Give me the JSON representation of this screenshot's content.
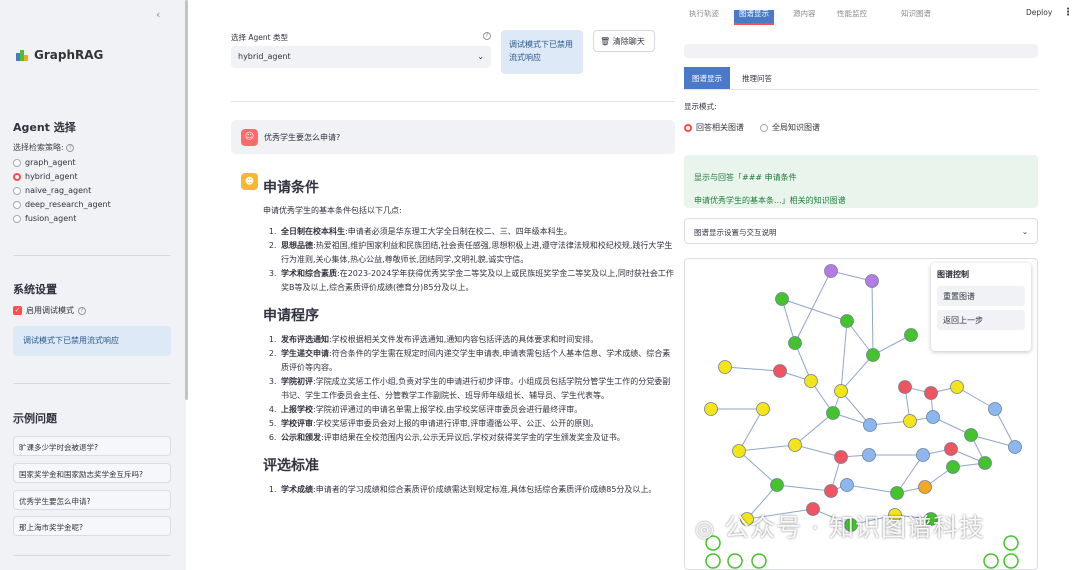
{
  "sidebar": {
    "logo_text": "GraphRAG",
    "agent_section_title": "Agent 选择",
    "strategy_label": "选择检索策略:",
    "agents": [
      "graph_agent",
      "hybrid_agent",
      "naive_rag_agent",
      "deep_research_agent",
      "fusion_agent"
    ],
    "selected_agent": "hybrid_agent",
    "settings_title": "系统设置",
    "debug_label": "启用调试模式",
    "debug_info": "调试模式下已禁用流式响应",
    "examples_title": "示例问题",
    "examples": [
      "旷课多少学时会被退学?",
      "国家奖学金和国家励志奖学金互斥吗?",
      "优秀学生要怎么申请?",
      "那上海市奖学金呢?"
    ]
  },
  "header": {
    "deploy": "Deploy"
  },
  "main": {
    "agent_type_label": "选择 Agent 类型",
    "agent_type_value": "hybrid_agent",
    "warning": "调试模式下已禁用流式响应",
    "clear_button": "清除聊天",
    "user_question": "优秀学生要怎么申请?",
    "answer": {
      "h1": "申请条件",
      "intro": "申请优秀学生的基本条件包括以下几点:",
      "conditions": [
        {
          "b": "全日制在校本科生",
          "t": ":申请者必须是华东理工大学全日制在校二、三、四年级本科生。"
        },
        {
          "b": "思想品德",
          "t": ":热爱祖国,维护国家利益和民族团结,社会责任感强,思想积极上进,遵守法律法规和校纪校规,践行大学生行为准则,关心集体,热心公益,尊敬师长,团结同学,文明礼貌,诚实守信。"
        },
        {
          "b": "学术和综合素质",
          "t": ":在2023-2024学年获得优秀奖学金二等奖及以上或民族班奖学金二等奖及以上,同时获社会工作奖B等及以上,综合素质评价成绩(德育分)85分及以上。"
        }
      ],
      "h2": "申请程序",
      "procedures": [
        {
          "b": "发布评选通知",
          "t": ":学校根据相关文件发布评选通知,通知内容包括评选的具体要求和时间安排。"
        },
        {
          "b": "学生递交申请",
          "t": ":符合条件的学生需在规定时间内递交学生申请表,申请表需包括个人基本信息、学术成绩、综合素质评价等内容。"
        },
        {
          "b": "学院初评",
          "t": ":学院成立奖惩工作小组,负责对学生的申请进行初步评审。小组成员包括学院分管学生工作的分党委副书记、学生工作委员会主任、分管教学工作副院长、班导师年级组长、辅导员、学生代表等。"
        },
        {
          "b": "上报学校",
          "t": ":学院初评通过的申请名单需上报学校,由学校奖惩评审委员会进行最终评审。"
        },
        {
          "b": "学校评审",
          "t": ":学校奖惩评审委员会对上报的申请进行评审,评审遵循公平、公正、公开的原则。"
        },
        {
          "b": "公示和颁发",
          "t": ":评审结果在全校范围内公示,公示无异议后,学校对获得奖学金的学生颁发奖金及证书。"
        }
      ],
      "h3": "评选标准",
      "criteria": [
        {
          "b": "学术成绩",
          "t": ":申请者的学习成绩和综合素质评价成绩需达到规定标准,具体包括综合素质评价成绩85分及以上。"
        }
      ]
    }
  },
  "right": {
    "top_tabs": [
      "执行轨迹",
      "图谱显示",
      "源内容",
      "性能监控",
      "知识图谱"
    ],
    "active_top_tab": 1,
    "tabs": [
      "图谱显示",
      "推理问答"
    ],
    "display_mode_label": "显示模式:",
    "modes": [
      "回答相关图谱",
      "全局知识图谱"
    ],
    "selected_mode": "回答相关图谱",
    "success_line1": "显示与回答「### 申请条件",
    "success_line2": "申请优秀学生的基本条...」相关的知识图谱",
    "expander_label": "图谱显示设置与交互说明",
    "graph_control_title": "图谱控制",
    "graph_buttons": [
      "重置图谱",
      "返回上一步"
    ]
  },
  "watermark": "公众号 · 知识图谱科技",
  "colors": {
    "accent": "#ff4b4b",
    "tab_blue": "#4a79c9",
    "node_green": "#44c42c",
    "node_yellow": "#f4e41a",
    "node_red": "#ef5561",
    "node_blue": "#8fb7ef",
    "node_purple": "#b57be3",
    "node_orange": "#f5a623"
  }
}
